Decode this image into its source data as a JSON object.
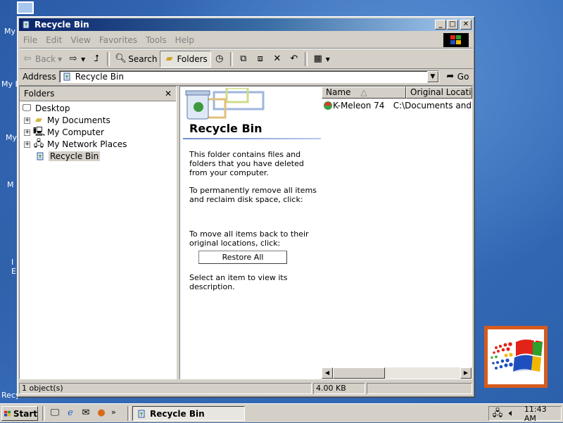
{
  "window": {
    "title": "Recycle Bin",
    "controls": {
      "minimize": "_",
      "maximize": "□",
      "close": "✕"
    }
  },
  "menu": [
    "File",
    "Edit",
    "View",
    "Favorites",
    "Tools",
    "Help"
  ],
  "toolbar": {
    "back": "Back",
    "forward_icon": "arrow-right-icon",
    "search": "Search",
    "folders": "Folders",
    "dropdown_glyph": "▾"
  },
  "address": {
    "label": "Address",
    "value": "Recycle Bin",
    "go": "Go"
  },
  "folders_pane": {
    "title": "Folders",
    "close_glyph": "✕",
    "items": [
      {
        "label": "Desktop",
        "icon": "desktop-icon"
      },
      {
        "label": "My Documents",
        "icon": "folder-icon",
        "expander": "+"
      },
      {
        "label": "My Computer",
        "icon": "computer-icon",
        "expander": "+"
      },
      {
        "label": "My Network Places",
        "icon": "network-icon",
        "expander": "+"
      },
      {
        "label": "Recycle Bin",
        "icon": "recycle-bin-icon"
      }
    ]
  },
  "info_panel": {
    "title": "Recycle Bin",
    "p1": "This folder contains files and folders that you have deleted from your computer.",
    "p2": "To permanently remove all items and reclaim disk space, click:",
    "p3": "To move all items back to their original locations, click:",
    "restore_button": "Restore All",
    "p4": "Select an item to view its description."
  },
  "list": {
    "columns": [
      "Name",
      "Original Location"
    ],
    "sort_glyph": "△",
    "rows": [
      {
        "name": "K-Meleon 74",
        "location": "C:\\Documents and"
      }
    ]
  },
  "status": {
    "objects": "1 object(s)",
    "size": "4.00 KB"
  },
  "taskbar": {
    "start": "Start",
    "quicklaunch_more": "»",
    "task": "Recycle Bin",
    "clock": "11:43 AM"
  },
  "desktop": {
    "labels": [
      "My",
      "My D",
      "My",
      "M",
      "I",
      "E",
      "Recycle Bin"
    ]
  },
  "colors": {
    "titlebar": "#0a246a",
    "desktop": "#3a6ea5",
    "face": "#d4d0c8"
  }
}
